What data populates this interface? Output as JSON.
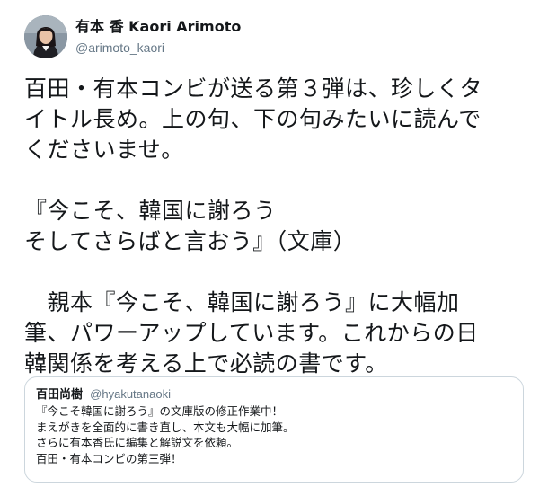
{
  "author": {
    "display_name": "有本 香 Kaori Arimoto",
    "handle": "@arimoto_kaori",
    "avatar_icon": "profile-photo"
  },
  "tweet": {
    "lines": [
      "百田・有本コンビが送る第３弾は、珍しくタ",
      "イトル長め。上の句、下の句みたいに読んで",
      "くださいませ。",
      "",
      "『今こそ、韓国に謝ろう",
      "そしてさらばと言おう』（文庫）",
      "",
      "　親本『今こそ、韓国に謝ろう』に大幅加",
      "筆、パワーアップしています。これからの日",
      "韓関係を考える上で必読の書です。"
    ]
  },
  "quoted_tweet": {
    "display_name": "百田尚樹",
    "handle": "@hyakutanaoki",
    "lines": [
      "『今こそ韓国に謝ろう』の文庫版の修正作業中！",
      "まえがきを全面的に書き直し、本文も大幅に加筆。",
      "さらに有本香氏に編集と解説文を依頼。",
      "百田・有本コンビの第三弾！"
    ]
  },
  "colors": {
    "text": "#14171a",
    "secondary": "#657786",
    "border": "#ccd6dd"
  }
}
